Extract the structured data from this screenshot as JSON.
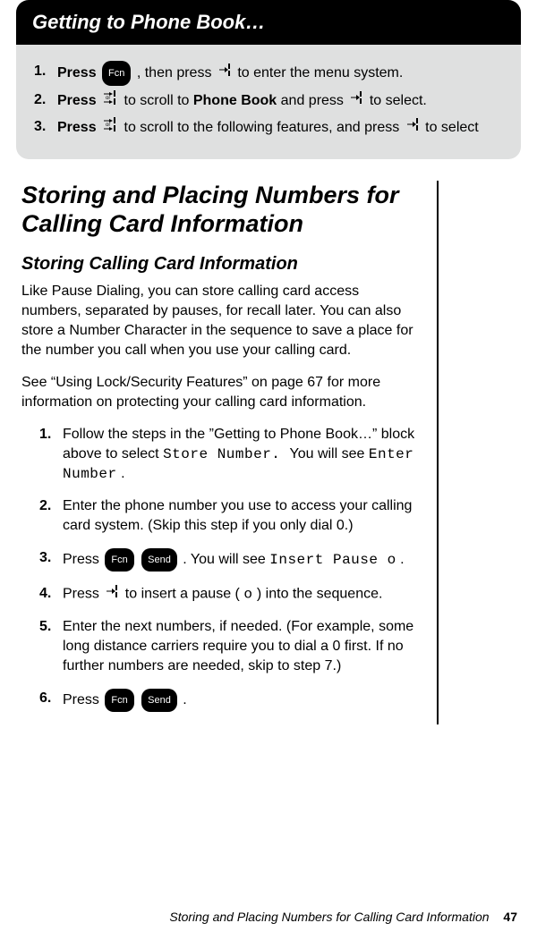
{
  "header": {
    "title": "Getting to Phone Book…"
  },
  "instructions": [
    {
      "num": "1.",
      "parts": {
        "press": "Press",
        "btn": "Fcn",
        "a": ", then press ",
        "b": " to enter the menu system."
      }
    },
    {
      "num": "2.",
      "parts": {
        "press": "Press ",
        "a": " to scroll to ",
        "pb": "Phone Book",
        "b": " and press ",
        "c": " to select."
      }
    },
    {
      "num": "3.",
      "parts": {
        "press": "Press ",
        "a": " to scroll to the following features, and press ",
        "b": " to select"
      }
    }
  ],
  "section": {
    "title": "Storing and Placing Numbers for Calling Card Information",
    "subtitle": "Storing Calling Card Information",
    "para1": "Like Pause Dialing, you can store calling card access numbers, separated by pauses, for recall later. You can also store a Number Character in the sequence to save a place for the number you call when you use your calling card.",
    "para2": "See “Using Lock/Security Features” on page 67 for more information on protecting your calling card information.",
    "steps": {
      "s1a": "Follow the steps in the ”Getting to Phone Book…” block above to select ",
      "s1lcd": "Store Number. ",
      "s1b": "You will see ",
      "s1lcd2": "Enter Number",
      "s1c": ".",
      "s2": "Enter the phone number you use to access your calling card system. (Skip this step if you only dial 0.)",
      "s3a": "Press ",
      "s3btn1": "Fcn",
      "s3btn2": "Send",
      "s3b": ". You will see ",
      "s3lcd": "Insert Pause o",
      "s3c": ".",
      "s4a": "Press ",
      "s4b": " to insert a pause (",
      "s4lcd": "o",
      "s4c": ") into the sequence.",
      "s5": "Enter the next numbers, if needed. (For example, some long distance carriers require you to dial a 0 first. If no further numbers are needed, skip to step 7.)",
      "s6a": "Press ",
      "s6btn1": "Fcn",
      "s6btn2": "Send",
      "s6b": "."
    }
  },
  "footer": {
    "text": "Storing and Placing Numbers for Calling Card Information",
    "page": "47"
  }
}
